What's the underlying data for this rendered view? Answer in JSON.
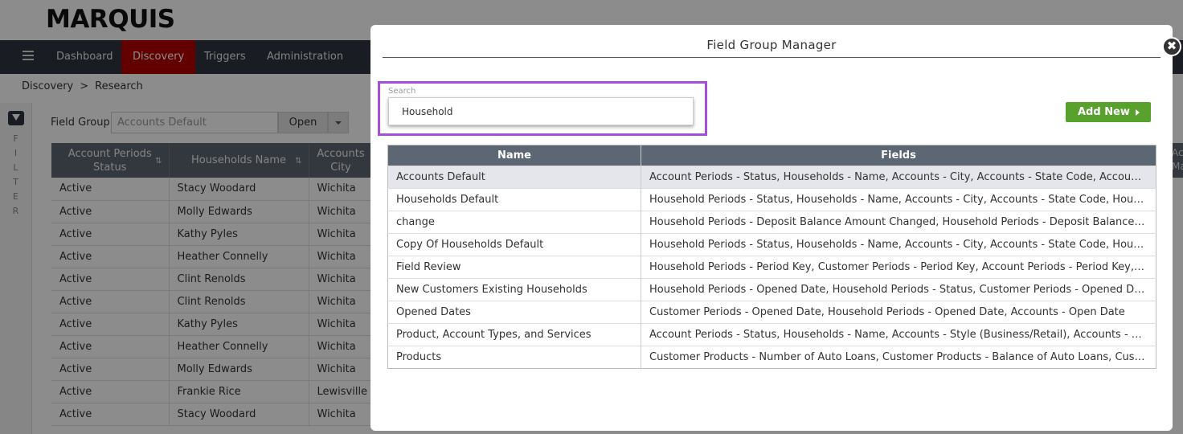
{
  "app": {
    "logo_text": "MARQUIS"
  },
  "nav": {
    "items": [
      {
        "label": "Dashboard"
      },
      {
        "label": "Discovery"
      },
      {
        "label": "Triggers"
      },
      {
        "label": "Administration"
      }
    ]
  },
  "breadcrumb": [
    "Discovery",
    ">",
    "Research"
  ],
  "side_filter": {
    "label": "FILTER"
  },
  "field_group": {
    "label": "Field Group",
    "value": "Accounts Default",
    "open_label": "Open"
  },
  "bg_table": {
    "headers": [
      "Account Periods Status",
      "Households Name",
      "Accounts City"
    ],
    "rows": [
      [
        "Active",
        "Stacy Woodard",
        "Wichita"
      ],
      [
        "Active",
        "Molly Edwards",
        "Wichita"
      ],
      [
        "Active",
        "Kathy Pyles",
        "Wichita"
      ],
      [
        "Active",
        "Heather Connelly",
        "Wichita"
      ],
      [
        "Active",
        "Clint Renolds",
        "Wichita"
      ],
      [
        "Active",
        "Clint Renolds",
        "Wichita"
      ],
      [
        "Active",
        "Kathy Pyles",
        "Wichita"
      ],
      [
        "Active",
        "Heather Connelly",
        "Wichita"
      ],
      [
        "Active",
        "Molly Edwards",
        "Wichita"
      ],
      [
        "Active",
        "Frankie Rice",
        "Lewisville"
      ],
      [
        "Active",
        "Stacy Woodard",
        "Wichita"
      ]
    ],
    "right_edge_text": "Acc Ma"
  },
  "modal": {
    "title": "Field Group Manager",
    "close_symbol": "✖",
    "search": {
      "label": "Search",
      "value": "Household",
      "placeholder": ""
    },
    "add_new_label": "Add New",
    "table": {
      "headers": [
        "Name",
        "Fields"
      ],
      "rows": [
        {
          "name": "Accounts Default",
          "fields": "Account Periods - Status, Households - Name, Accounts - City, Accounts - State Code, Accounts - State Code, Accounts - Style"
        },
        {
          "name": "Households Default",
          "fields": "Household Periods - Status, Households - Name, Accounts - City, Accounts - State Code, Household Periods - Deposit Balance"
        },
        {
          "name": "change",
          "fields": "Household Periods - Deposit Balance Amount Changed, Household Periods - Deposit Balance Percent Changed"
        },
        {
          "name": "Copy Of Households Default",
          "fields": "Household Periods - Status, Households - Name, Accounts - City, Accounts - State Code, Household Periods - Deposit Balance"
        },
        {
          "name": "Field Review",
          "fields": "Household Periods - Period Key, Customer Periods - Period Key, Account Periods - Period Key, Households - Key"
        },
        {
          "name": "New Customers Existing Households",
          "fields": "Household Periods - Opened Date, Household Periods - Status, Customer Periods - Opened Date, Customer Periods - Status"
        },
        {
          "name": "Opened Dates",
          "fields": "Customer Periods - Opened Date, Household Periods - Opened Date, Accounts - Open Date"
        },
        {
          "name": "Product, Account Types, and Services",
          "fields": "Account Periods - Status, Households - Name, Accounts - Style (Business/Retail), Accounts - Product Type"
        },
        {
          "name": "Products",
          "fields": "Customer Products - Number of Auto Loans, Customer Products - Balance of Auto Loans, Customer Products - Number of Mortgages"
        }
      ]
    }
  },
  "colors": {
    "navbar": "#2e3641",
    "active_nav": "#b30000",
    "table_header": "#5d6673",
    "add_button": "#58a12c",
    "highlight": "#a64ed6"
  }
}
